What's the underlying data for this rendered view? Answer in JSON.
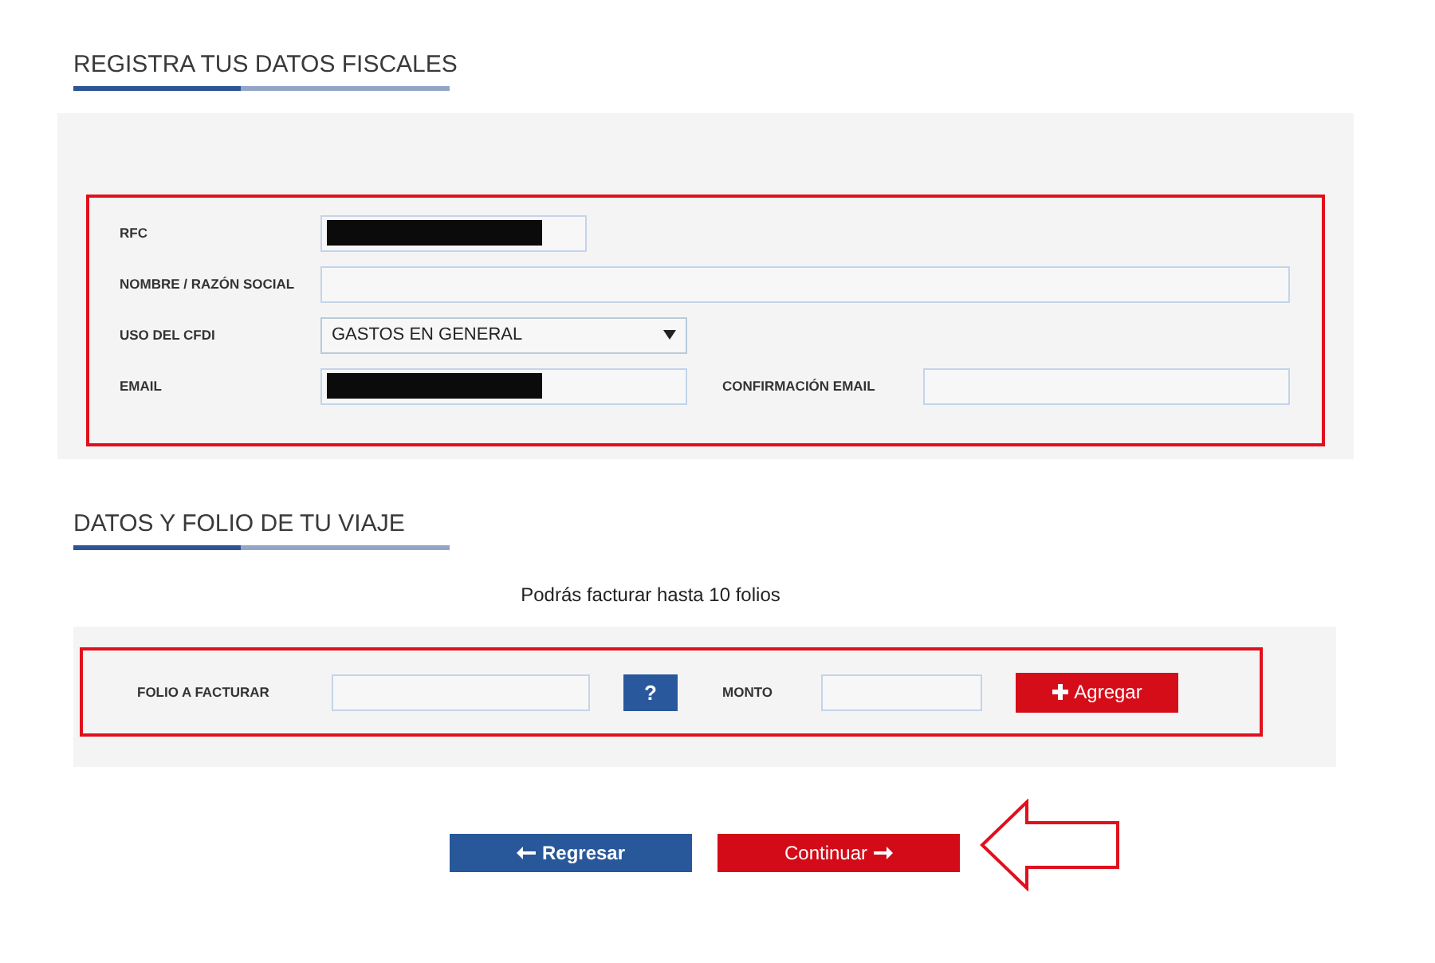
{
  "fiscal_section": {
    "title": "REGISTRA TUS DATOS FISCALES",
    "highlighted": true,
    "rows": [
      {
        "fields": [
          {
            "label": "RFC",
            "kind": "text",
            "redacted": true
          }
        ]
      },
      {
        "fields": [
          {
            "label": "NOMBRE / RAZÓN SOCIAL",
            "kind": "text",
            "redacted": false
          }
        ]
      },
      {
        "fields": [
          {
            "label": "USO DEL CFDI",
            "kind": "select",
            "value": "GASTOS EN GENERAL"
          }
        ]
      },
      {
        "fields": [
          {
            "label": "EMAIL",
            "kind": "text",
            "redacted": true
          },
          {
            "label": "CONFIRMACIÓN EMAIL",
            "kind": "text",
            "redacted": false
          }
        ]
      }
    ]
  },
  "trip_section": {
    "title": "DATOS Y FOLIO DE TU VIAJE",
    "note": "Podrás facturar hasta 10 folios",
    "highlighted": true,
    "folio_label": "FOLIO A FACTURAR",
    "help_button": "?",
    "amount_label": "MONTO",
    "add_button": "Agregar"
  },
  "buttons": [
    {
      "label": "Regresar",
      "kind": "back"
    },
    {
      "label": "Continuar",
      "kind": "next"
    }
  ],
  "pointer_arrow": true
}
